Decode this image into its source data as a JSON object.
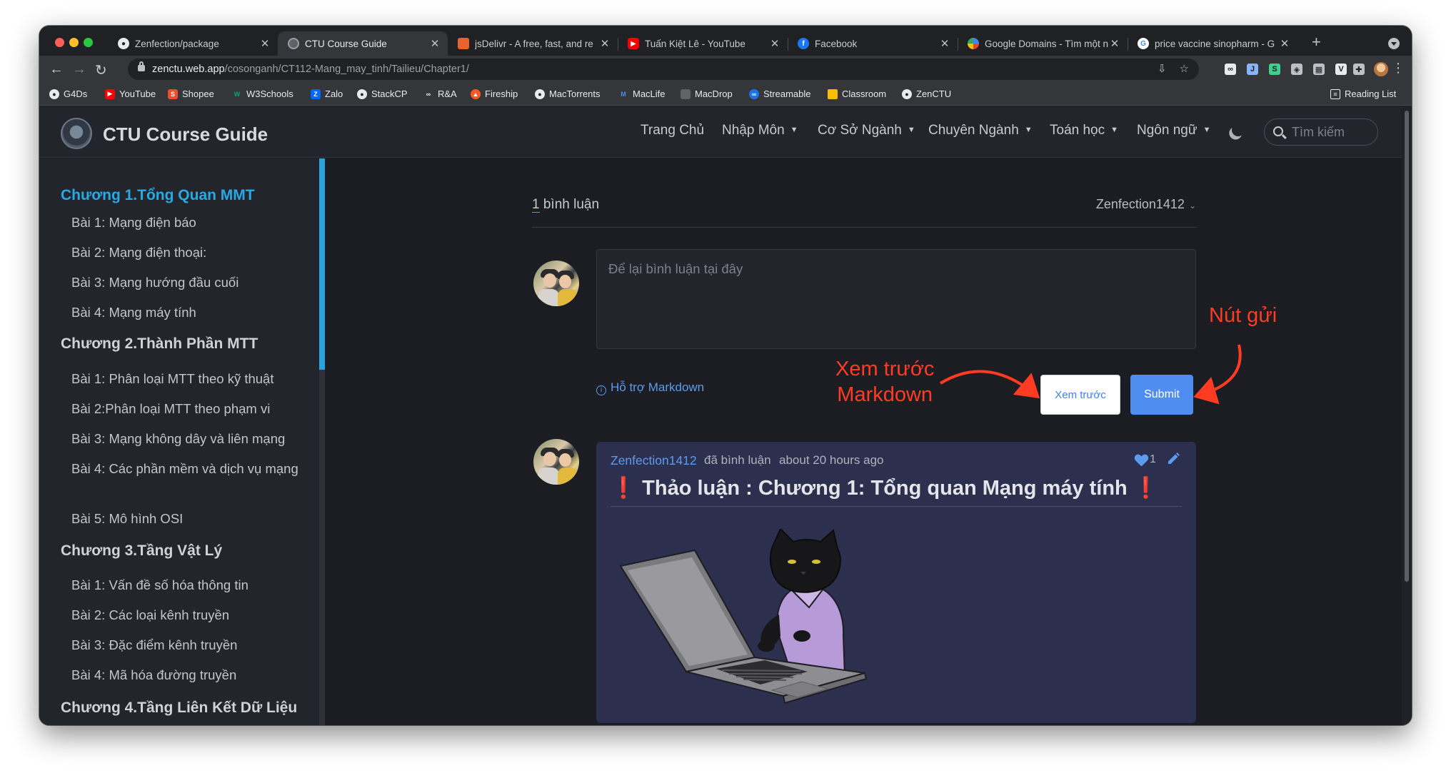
{
  "browser": {
    "tabs": [
      {
        "label": "Zenfection/package",
        "icon": "github-icon",
        "active": false
      },
      {
        "label": "CTU Course Guide",
        "icon": "site-icon",
        "active": true
      },
      {
        "label": "jsDelivr - A free, fast, and re",
        "icon": "jsdelivr-icon",
        "active": false
      },
      {
        "label": "Tuấn Kiệt Lê - YouTube",
        "icon": "youtube-icon",
        "active": false
      },
      {
        "label": "Facebook",
        "icon": "facebook-icon",
        "active": false
      },
      {
        "label": "Google Domains - Tìm một n",
        "icon": "google-domains-icon",
        "active": false
      },
      {
        "label": "price vaccine sinopharm - G",
        "icon": "google-icon",
        "active": false
      }
    ],
    "url_host": "zenctu.web.app",
    "url_path": "/cosonganh/CT112-Mang_may_tinh/Tailieu/Chapter1/",
    "bookmarks": [
      "G4Ds",
      "YouTube",
      "Shopee",
      "W3Schools",
      "Zalo",
      "StackCP",
      "R&A",
      "Fireship",
      "MacTorrents",
      "MacLife",
      "MacDrop",
      "Streamable",
      "Classroom",
      "ZenCTU"
    ],
    "reading_list": "Reading List",
    "colors": {
      "accent": "#27a9e6",
      "link": "#5b9cf0",
      "submit": "#4f8ef0",
      "annotation": "#ff3b21"
    }
  },
  "site": {
    "title": "CTU Course Guide",
    "nav": [
      {
        "label": "Trang Chủ",
        "dropdown": false
      },
      {
        "label": "Nhập Môn",
        "dropdown": true
      },
      {
        "label": "Cơ Sở Ngành",
        "dropdown": true
      },
      {
        "label": "Chuyên Ngành",
        "dropdown": true
      },
      {
        "label": "Toán học",
        "dropdown": true
      },
      {
        "label": "Ngôn ngữ",
        "dropdown": true
      }
    ],
    "search_placeholder": "Tìm kiếm"
  },
  "sidebar": {
    "chapters": [
      {
        "title": "Chương 1.Tổng Quan MMT",
        "active": true,
        "lessons": [
          "Bài 1: Mạng điện báo",
          "Bài 2: Mạng điện thoại:",
          "Bài 3: Mạng hướng đầu cuối",
          "Bài 4: Mạng máy tính"
        ]
      },
      {
        "title": "Chương 2.Thành Phần MTT",
        "active": false,
        "lessons": [
          "Bài 1: Phân loại MTT theo kỹ thuật",
          "Bài 2:Phân loại MTT theo phạm vi",
          "Bài 3: Mạng không dây và liên mạng",
          "Bài 4: Các phần mềm và dịch vụ mạng",
          "Bài 5: Mô hình OSI"
        ]
      },
      {
        "title": "Chương 3.Tầng Vật Lý",
        "active": false,
        "lessons": [
          "Bài 1: Vấn đề số hóa thông tin",
          "Bài 2: Các loại kênh truyền",
          "Bài 3: Đặc điểm kênh truyền",
          "Bài 4: Mã hóa đường truyền"
        ]
      },
      {
        "title": "Chương 4.Tầng Liên Kết Dữ Liệu",
        "active": false,
        "lessons": []
      }
    ]
  },
  "comments": {
    "count": "1",
    "count_label": " bình luận",
    "current_user": "Zenfection1412",
    "placeholder": "Để lại bình luận tại đây",
    "markdown_support": "Hỗ trợ Markdown",
    "preview_label": "Xem trước",
    "submit_label": "Submit",
    "annotation_submit": "Nút gửi",
    "annotation_preview_line1": "Xem trước",
    "annotation_preview_line2": "Markdown",
    "items": [
      {
        "author": "Zenfection1412",
        "action": "đã bình luận",
        "time": "about 20 hours ago",
        "likes": "1",
        "title_mark_left": "❗",
        "title": "Thảo luận : Chương 1: Tổng quan Mạng máy tính",
        "title_mark_right": "❗"
      }
    ]
  }
}
